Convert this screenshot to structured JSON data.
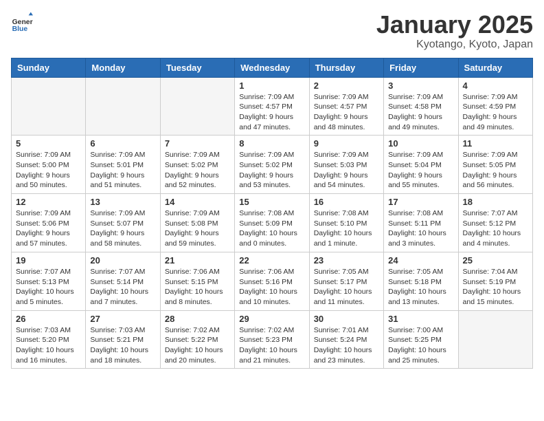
{
  "header": {
    "logo_general": "General",
    "logo_blue": "Blue",
    "title": "January 2025",
    "subtitle": "Kyotango, Kyoto, Japan"
  },
  "weekdays": [
    "Sunday",
    "Monday",
    "Tuesday",
    "Wednesday",
    "Thursday",
    "Friday",
    "Saturday"
  ],
  "weeks": [
    [
      {
        "day": "",
        "empty": true
      },
      {
        "day": "",
        "empty": true
      },
      {
        "day": "",
        "empty": true
      },
      {
        "day": "1",
        "sunrise": "7:09 AM",
        "sunset": "4:57 PM",
        "daylight": "9 hours and 47 minutes."
      },
      {
        "day": "2",
        "sunrise": "7:09 AM",
        "sunset": "4:57 PM",
        "daylight": "9 hours and 48 minutes."
      },
      {
        "day": "3",
        "sunrise": "7:09 AM",
        "sunset": "4:58 PM",
        "daylight": "9 hours and 49 minutes."
      },
      {
        "day": "4",
        "sunrise": "7:09 AM",
        "sunset": "4:59 PM",
        "daylight": "9 hours and 49 minutes."
      }
    ],
    [
      {
        "day": "5",
        "sunrise": "7:09 AM",
        "sunset": "5:00 PM",
        "daylight": "9 hours and 50 minutes."
      },
      {
        "day": "6",
        "sunrise": "7:09 AM",
        "sunset": "5:01 PM",
        "daylight": "9 hours and 51 minutes."
      },
      {
        "day": "7",
        "sunrise": "7:09 AM",
        "sunset": "5:02 PM",
        "daylight": "9 hours and 52 minutes."
      },
      {
        "day": "8",
        "sunrise": "7:09 AM",
        "sunset": "5:02 PM",
        "daylight": "9 hours and 53 minutes."
      },
      {
        "day": "9",
        "sunrise": "7:09 AM",
        "sunset": "5:03 PM",
        "daylight": "9 hours and 54 minutes."
      },
      {
        "day": "10",
        "sunrise": "7:09 AM",
        "sunset": "5:04 PM",
        "daylight": "9 hours and 55 minutes."
      },
      {
        "day": "11",
        "sunrise": "7:09 AM",
        "sunset": "5:05 PM",
        "daylight": "9 hours and 56 minutes."
      }
    ],
    [
      {
        "day": "12",
        "sunrise": "7:09 AM",
        "sunset": "5:06 PM",
        "daylight": "9 hours and 57 minutes."
      },
      {
        "day": "13",
        "sunrise": "7:09 AM",
        "sunset": "5:07 PM",
        "daylight": "9 hours and 58 minutes."
      },
      {
        "day": "14",
        "sunrise": "7:09 AM",
        "sunset": "5:08 PM",
        "daylight": "9 hours and 59 minutes."
      },
      {
        "day": "15",
        "sunrise": "7:08 AM",
        "sunset": "5:09 PM",
        "daylight": "10 hours and 0 minutes."
      },
      {
        "day": "16",
        "sunrise": "7:08 AM",
        "sunset": "5:10 PM",
        "daylight": "10 hours and 1 minute."
      },
      {
        "day": "17",
        "sunrise": "7:08 AM",
        "sunset": "5:11 PM",
        "daylight": "10 hours and 3 minutes."
      },
      {
        "day": "18",
        "sunrise": "7:07 AM",
        "sunset": "5:12 PM",
        "daylight": "10 hours and 4 minutes."
      }
    ],
    [
      {
        "day": "19",
        "sunrise": "7:07 AM",
        "sunset": "5:13 PM",
        "daylight": "10 hours and 5 minutes."
      },
      {
        "day": "20",
        "sunrise": "7:07 AM",
        "sunset": "5:14 PM",
        "daylight": "10 hours and 7 minutes."
      },
      {
        "day": "21",
        "sunrise": "7:06 AM",
        "sunset": "5:15 PM",
        "daylight": "10 hours and 8 minutes."
      },
      {
        "day": "22",
        "sunrise": "7:06 AM",
        "sunset": "5:16 PM",
        "daylight": "10 hours and 10 minutes."
      },
      {
        "day": "23",
        "sunrise": "7:05 AM",
        "sunset": "5:17 PM",
        "daylight": "10 hours and 11 minutes."
      },
      {
        "day": "24",
        "sunrise": "7:05 AM",
        "sunset": "5:18 PM",
        "daylight": "10 hours and 13 minutes."
      },
      {
        "day": "25",
        "sunrise": "7:04 AM",
        "sunset": "5:19 PM",
        "daylight": "10 hours and 15 minutes."
      }
    ],
    [
      {
        "day": "26",
        "sunrise": "7:03 AM",
        "sunset": "5:20 PM",
        "daylight": "10 hours and 16 minutes."
      },
      {
        "day": "27",
        "sunrise": "7:03 AM",
        "sunset": "5:21 PM",
        "daylight": "10 hours and 18 minutes."
      },
      {
        "day": "28",
        "sunrise": "7:02 AM",
        "sunset": "5:22 PM",
        "daylight": "10 hours and 20 minutes."
      },
      {
        "day": "29",
        "sunrise": "7:02 AM",
        "sunset": "5:23 PM",
        "daylight": "10 hours and 21 minutes."
      },
      {
        "day": "30",
        "sunrise": "7:01 AM",
        "sunset": "5:24 PM",
        "daylight": "10 hours and 23 minutes."
      },
      {
        "day": "31",
        "sunrise": "7:00 AM",
        "sunset": "5:25 PM",
        "daylight": "10 hours and 25 minutes."
      },
      {
        "day": "",
        "empty": true
      }
    ]
  ]
}
